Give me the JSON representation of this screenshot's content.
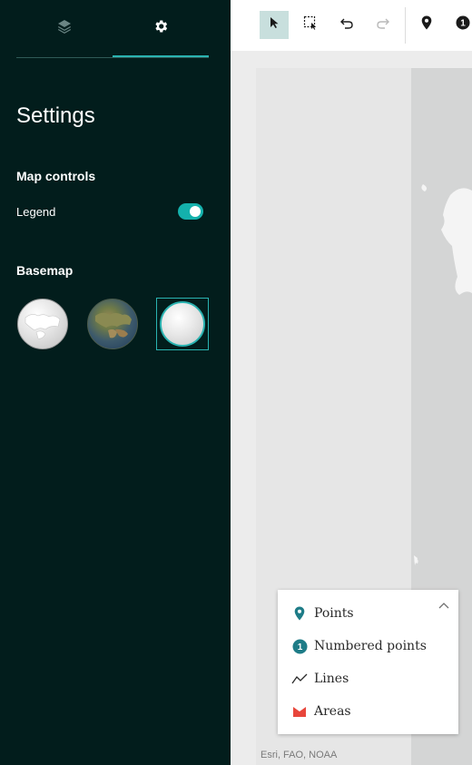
{
  "sidebar": {
    "tabs": [
      {
        "name": "layers",
        "icon": "layers-icon"
      },
      {
        "name": "settings",
        "icon": "gear-icon",
        "active": true
      }
    ],
    "title": "Settings",
    "map_controls": {
      "heading": "Map controls",
      "legend_label": "Legend",
      "legend_enabled": true
    },
    "basemap": {
      "heading": "Basemap",
      "options": [
        {
          "name": "light-gray",
          "selected": false
        },
        {
          "name": "imagery",
          "selected": false
        },
        {
          "name": "light-gray-selected",
          "selected": true
        }
      ]
    }
  },
  "toolbar": {
    "tools": [
      "select-pointer",
      "select-box",
      "undo",
      "redo",
      "point",
      "numbered-point"
    ],
    "active_tool": "select-pointer",
    "numbered_point_badge": "1"
  },
  "legend": {
    "items": [
      {
        "label": "Points",
        "icon": "pin-icon"
      },
      {
        "label": "Numbered points",
        "icon": "numbered-point-icon",
        "badge": "1"
      },
      {
        "label": "Lines",
        "icon": "line-icon"
      },
      {
        "label": "Areas",
        "icon": "area-icon"
      }
    ]
  },
  "map": {
    "attribution": "Esri, FAO, NOAA"
  },
  "colors": {
    "sidebar_bg": "#021d1c",
    "accent": "#2ab3b1",
    "toggle_on": "#14b1ac",
    "pin": "#1e7c87",
    "area": "#e8463b"
  }
}
